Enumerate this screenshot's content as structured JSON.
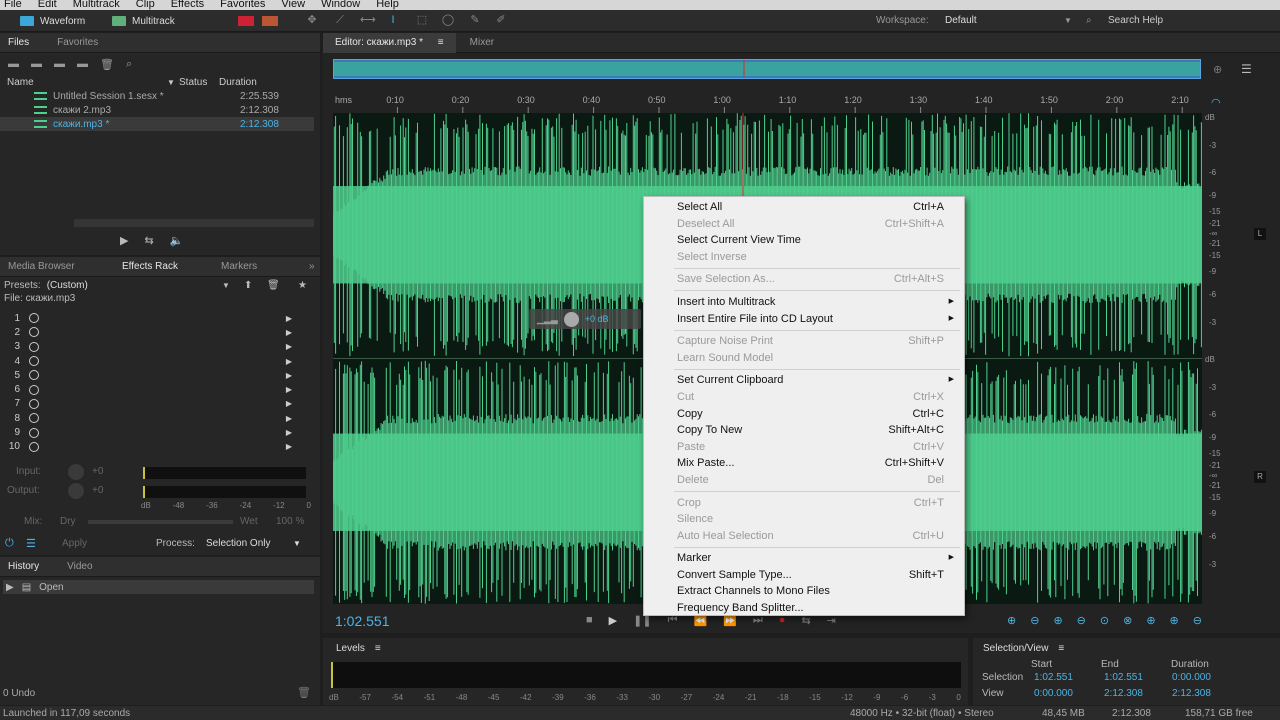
{
  "menu": [
    "File",
    "Edit",
    "Multitrack",
    "Clip",
    "Effects",
    "Favorites",
    "View",
    "Window",
    "Help"
  ],
  "toolbar": {
    "waveform": "Waveform",
    "multitrack": "Multitrack",
    "workspace_label": "Workspace:",
    "workspace_value": "Default",
    "search_help": "Search Help"
  },
  "files_panel": {
    "tab_files": "Files",
    "tab_favorites": "Favorites",
    "col_name": "Name",
    "col_status": "Status",
    "col_duration": "Duration",
    "rows": [
      {
        "name": "Untitled Session 1.sesx *",
        "duration": "2:25.539"
      },
      {
        "name": "скажи 2.mp3",
        "duration": "2:12.308"
      },
      {
        "name": "скажи.mp3 *",
        "duration": "2:12.308"
      }
    ]
  },
  "effects_panel": {
    "tab_media": "Media Browser",
    "tab_effects": "Effects Rack",
    "tab_markers": "Markers",
    "presets_label": "Presets:",
    "presets_value": "(Custom)",
    "file_label": "File: скажи.mp3",
    "slots": [
      "1",
      "2",
      "3",
      "4",
      "5",
      "6",
      "7",
      "8",
      "9",
      "10"
    ],
    "input_label": "Input:",
    "input_value": "+0",
    "output_label": "Output:",
    "output_value": "+0",
    "meter_ticks": [
      "dB",
      "-48",
      "-36",
      "-24",
      "-12",
      "0"
    ],
    "mix_label": "Mix:",
    "dry_label": "Dry",
    "wet_label": "Wet",
    "wet_value": "100 %",
    "apply": "Apply",
    "process_label": "Process:",
    "process_value": "Selection Only"
  },
  "history_panel": {
    "tab_history": "History",
    "tab_video": "Video",
    "item": "Open",
    "undo": "0 Undo"
  },
  "status": {
    "launched": "Launched in 117,09 seconds",
    "sample": "48000 Hz • 32-bit (float) • Stereo",
    "size": "48,45 MB",
    "duration": "2:12.308",
    "free": "158,71 GB free"
  },
  "editor": {
    "tab_editor": "Editor: скажи.mp3 *",
    "tab_mixer": "Mixer",
    "time": "1:02.551",
    "hud_db": "+0 dB",
    "ruler": [
      "hms",
      "0:10",
      "0:20",
      "0:30",
      "0:40",
      "0:50",
      "1:00",
      "1:10",
      "1:20",
      "1:30",
      "1:40",
      "1:50",
      "2:00",
      "2:10"
    ],
    "db_top": [
      "dB",
      "-3",
      "-6",
      "-9",
      "-15",
      "-21",
      "-∞",
      "-21",
      "-15",
      "-9",
      "-6",
      "-3"
    ],
    "db_bottom": [
      "dB",
      "-3",
      "-6",
      "-9",
      "-15",
      "-21",
      "-∞",
      "-21",
      "-15",
      "-9",
      "-6",
      "-3"
    ],
    "ch_left": "L",
    "ch_right": "R"
  },
  "levels": {
    "title": "Levels",
    "ticks": [
      "dB",
      "-57",
      "-54",
      "-51",
      "-48",
      "-45",
      "-42",
      "-39",
      "-36",
      "-33",
      "-30",
      "-27",
      "-24",
      "-21",
      "-18",
      "-15",
      "-12",
      "-9",
      "-6",
      "-3",
      "0"
    ]
  },
  "selection_view": {
    "title": "Selection/View",
    "col_start": "Start",
    "col_end": "End",
    "col_duration": "Duration",
    "selection_label": "Selection",
    "selection_start": "1:02.551",
    "selection_end": "1:02.551",
    "selection_duration": "0:00.000",
    "view_label": "View",
    "view_start": "0:00.000",
    "view_end": "2:12.308",
    "view_duration": "2:12.308"
  },
  "context_menu": [
    {
      "label": "Select All",
      "shortcut": "Ctrl+A",
      "enabled": true
    },
    {
      "label": "Deselect All",
      "shortcut": "Ctrl+Shift+A",
      "enabled": false
    },
    {
      "label": "Select Current View Time",
      "shortcut": "",
      "enabled": true
    },
    {
      "label": "Select Inverse",
      "shortcut": "",
      "enabled": false
    },
    {
      "sep": true
    },
    {
      "label": "Save Selection As...",
      "shortcut": "Ctrl+Alt+S",
      "enabled": false
    },
    {
      "sep": true
    },
    {
      "label": "Insert into Multitrack",
      "shortcut": "",
      "enabled": true,
      "submenu": true
    },
    {
      "label": "Insert Entire File into CD Layout",
      "shortcut": "",
      "enabled": true,
      "submenu": true
    },
    {
      "sep": true
    },
    {
      "label": "Capture Noise Print",
      "shortcut": "Shift+P",
      "enabled": false
    },
    {
      "label": "Learn Sound Model",
      "shortcut": "",
      "enabled": false
    },
    {
      "sep": true
    },
    {
      "label": "Set Current Clipboard",
      "shortcut": "",
      "enabled": true,
      "submenu": true
    },
    {
      "label": "Cut",
      "shortcut": "Ctrl+X",
      "enabled": false
    },
    {
      "label": "Copy",
      "shortcut": "Ctrl+C",
      "enabled": true
    },
    {
      "label": "Copy To New",
      "shortcut": "Shift+Alt+C",
      "enabled": true
    },
    {
      "label": "Paste",
      "shortcut": "Ctrl+V",
      "enabled": false
    },
    {
      "label": "Mix Paste...",
      "shortcut": "Ctrl+Shift+V",
      "enabled": true
    },
    {
      "label": "Delete",
      "shortcut": "Del",
      "enabled": false
    },
    {
      "sep": true
    },
    {
      "label": "Crop",
      "shortcut": "Ctrl+T",
      "enabled": false
    },
    {
      "label": "Silence",
      "shortcut": "",
      "enabled": false
    },
    {
      "label": "Auto Heal Selection",
      "shortcut": "Ctrl+U",
      "enabled": false
    },
    {
      "sep": true
    },
    {
      "label": "Marker",
      "shortcut": "",
      "enabled": true,
      "submenu": true
    },
    {
      "label": "Convert Sample Type...",
      "shortcut": "Shift+T",
      "enabled": true
    },
    {
      "label": "Extract Channels to Mono Files",
      "shortcut": "",
      "enabled": true
    },
    {
      "label": "Frequency Band Splitter...",
      "shortcut": "",
      "enabled": true
    }
  ],
  "colors": {
    "waveform": "#4fcf8e",
    "accent": "#4ab4e6",
    "playhead": "#d92a2a"
  }
}
